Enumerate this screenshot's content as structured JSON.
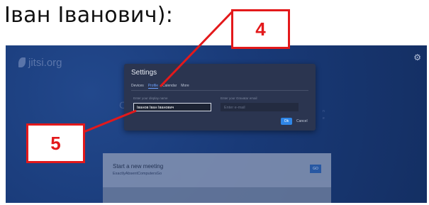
{
  "caption": "Іван Іванович):",
  "app": {
    "logo_text": "jitsi.org",
    "bg_heading": "C",
    "bg_side_right": "n",
    "bg_side_right2": "e"
  },
  "settings_dialog": {
    "title": "Settings",
    "tabs": [
      {
        "label": "Devices",
        "active": false
      },
      {
        "label": "Profile",
        "active": true
      },
      {
        "label": "Calendar",
        "active": false
      },
      {
        "label": "More",
        "active": false
      }
    ],
    "display_name_label": "Enter your display name",
    "display_name_value": "Іванов Іван Іванович",
    "email_label": "Enter your Gravatar email",
    "email_placeholder": "Enter e-mail",
    "ok_label": "Ok",
    "cancel_label": "Cancel"
  },
  "meeting_card": {
    "title": "Start a new meeting",
    "subtitle": "ExactlyAbsentComputersGo",
    "go_label": "GO"
  },
  "callouts": {
    "first": "4",
    "second": "5"
  },
  "colors": {
    "callout_red": "#e3191b",
    "app_background": "#193a78",
    "dialog_background": "#2b3550",
    "accent_blue": "#2f86e7"
  }
}
